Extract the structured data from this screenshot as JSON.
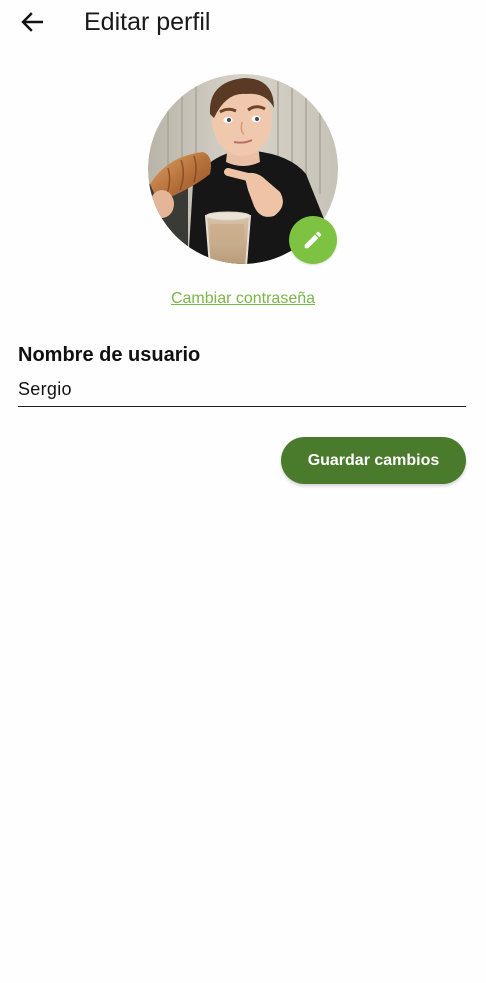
{
  "header": {
    "title": "Editar perfil",
    "back_icon": "arrow-back-icon"
  },
  "profile": {
    "avatar_alt": "Foto de perfil",
    "edit_icon": "pencil-icon",
    "accent_color": "#7ec242"
  },
  "links": {
    "change_password": "Cambiar contraseña"
  },
  "form": {
    "username_label": "Nombre de usuario",
    "username_value": "Sergio"
  },
  "actions": {
    "save_label": "Guardar cambios",
    "save_color": "#4a7a2c"
  }
}
